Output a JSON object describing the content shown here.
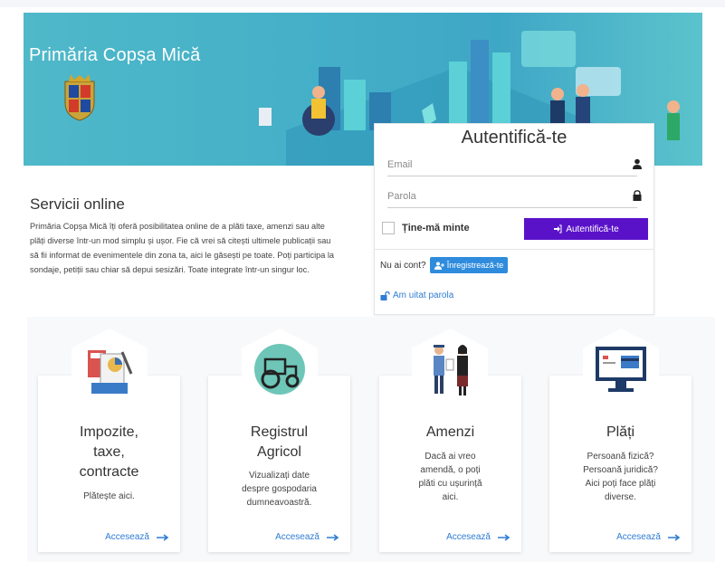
{
  "hero": {
    "title": "Primăria Copșa Mică",
    "colors": {
      "banner": "#45b0c8"
    }
  },
  "login": {
    "title": "Autentifică-te",
    "email_placeholder": "Email",
    "password_placeholder": "Parola",
    "remember_label": "Ține-mă minte",
    "submit_label": "Autentifică-te",
    "no_account": "Nu ai cont?",
    "register_label": "Înregistrează-te",
    "forgot_label": "Am uitat parola",
    "colors": {
      "submit": "#5a12c9",
      "register": "#2f8cdd",
      "link": "#2f7cd3"
    }
  },
  "services": {
    "title": "Servicii online",
    "lines": [
      "Primăria Copșa Mică îți oferă posibilitatea online de a plăti taxe, amenzi sau alte",
      "plăți diverse într-un mod simplu și ușor. Fie că vrei să citești ultimele publicații sau",
      "să fii informat de evenimentele din zona ta, aici le găsești pe toate. Poți participa la",
      "sondaje, petiții sau chiar să depui sesizări. Toate integrate într-un singur loc."
    ]
  },
  "cards": [
    {
      "title_lines": [
        "Impozite,",
        "taxe,",
        "contracte"
      ],
      "desc_lines": [
        "Plătește aici."
      ],
      "link": "Accesează",
      "icon": "calculator-docs-icon"
    },
    {
      "title_lines": [
        "Registrul",
        "Agricol"
      ],
      "desc_lines": [
        "Vizualizați date",
        "despre gospodaria",
        "dumneavoastră."
      ],
      "link": "Accesează",
      "icon": "tractor-icon"
    },
    {
      "title_lines": [
        "Amenzi"
      ],
      "desc_lines": [
        "Dacă ai vreo",
        "amendă, o poți",
        "plăti cu ușurință",
        "aici."
      ],
      "link": "Accesează",
      "icon": "police-officer-icon"
    },
    {
      "title_lines": [
        "Plăți"
      ],
      "desc_lines": [
        "Persoană fizică?",
        "Persoană juridică?",
        "Aici poți face plăți",
        "diverse."
      ],
      "link": "Accesează",
      "icon": "card-payment-monitor-icon"
    }
  ]
}
